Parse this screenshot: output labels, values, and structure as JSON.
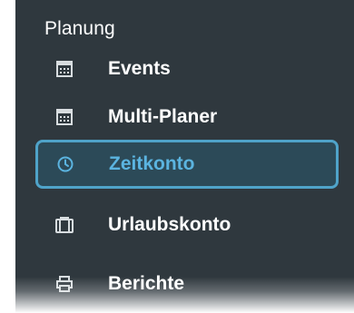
{
  "sidebar": {
    "section_title": "Planung",
    "items": [
      {
        "label": "Events",
        "icon": "calendar-icon",
        "active": false
      },
      {
        "label": "Multi-Planer",
        "icon": "calendar-icon",
        "active": false
      },
      {
        "label": "Zeitkonto",
        "icon": "clock-icon",
        "active": true
      },
      {
        "label": "Urlaubskonto",
        "icon": "suitcase-icon",
        "active": false
      },
      {
        "label": "Berichte",
        "icon": "printer-icon",
        "active": false
      }
    ]
  },
  "colors": {
    "background": "#2f383e",
    "active_background": "#2c4a58",
    "active_border": "#4fa3c9",
    "active_text": "#5bb4e0",
    "text": "#ffffff"
  }
}
